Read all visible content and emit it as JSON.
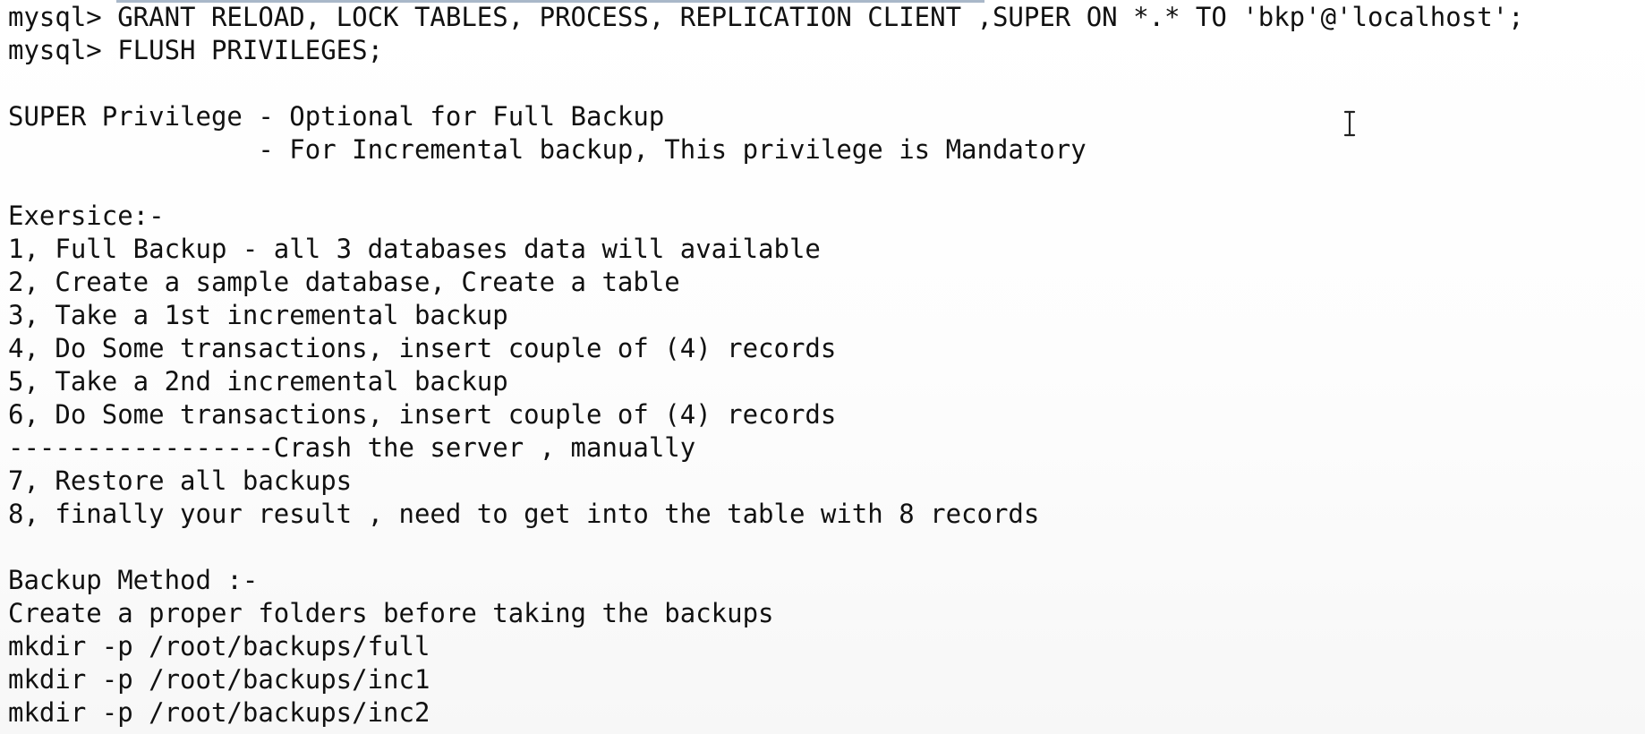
{
  "editor": {
    "lines": [
      "mysql> GRANT RELOAD, LOCK TABLES, PROCESS, REPLICATION CLIENT ,SUPER ON *.* TO 'bkp'@'localhost';",
      "mysql> FLUSH PRIVILEGES;",
      "",
      "SUPER Privilege - Optional for Full Backup",
      "                - For Incremental backup, This privilege is Mandatory",
      "",
      "Exersice:-",
      "1, Full Backup - all 3 databases data will available",
      "2, Create a sample database, Create a table",
      "3, Take a 1st incremental backup",
      "4, Do Some transactions, insert couple of (4) records",
      "5, Take a 2nd incremental backup",
      "6, Do Some transactions, insert couple of (4) records",
      "-----------------Crash the server , manually",
      "7, Restore all backups",
      "8, finally your result , need to get into the table with 8 records",
      "",
      "Backup Method :-",
      "Create a proper folders before taking the backups",
      "mkdir -p /root/backups/full",
      "mkdir -p /root/backups/inc1",
      "mkdir -p /root/backups/inc2"
    ]
  },
  "cursor": {
    "icon": "text-cursor-icon"
  },
  "colors": {
    "text": "#111111",
    "background": "#fefefe"
  }
}
